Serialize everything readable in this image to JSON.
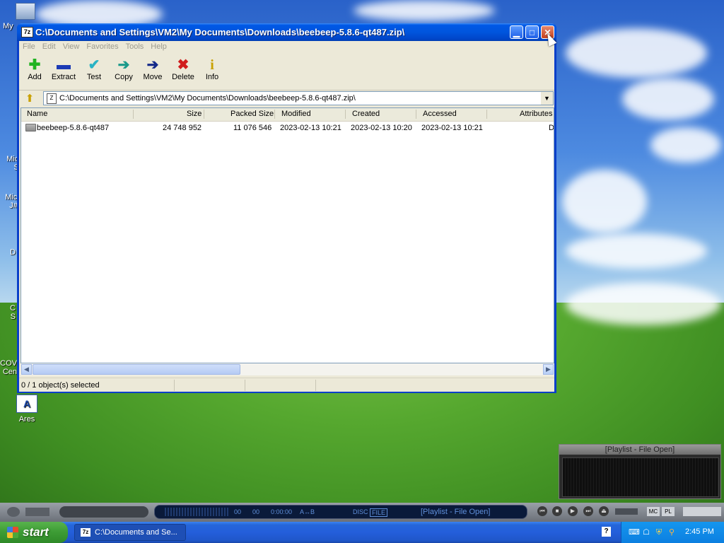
{
  "desktop": {
    "icons": [
      {
        "label": "My"
      },
      {
        "label": "M"
      },
      {
        "label": "Micro\nStu"
      },
      {
        "label": "Micro\nJ# 2"
      },
      {
        "label": "D"
      },
      {
        "label": "C\nS"
      },
      {
        "label": "COV\nCen"
      },
      {
        "label": "Ares"
      }
    ]
  },
  "window": {
    "title": "C:\\Documents and Settings\\VM2\\My Documents\\Downloads\\beebeep-5.8.6-qt487.zip\\",
    "app_icon": "7z",
    "menu": [
      "File",
      "Edit",
      "View",
      "Favorites",
      "Tools",
      "Help"
    ],
    "toolbar": [
      {
        "label": "Add",
        "icon": "plus-icon",
        "color": "#21b321",
        "glyph": "✚"
      },
      {
        "label": "Extract",
        "icon": "minus-icon",
        "color": "#1c3bb5",
        "glyph": "▬"
      },
      {
        "label": "Test",
        "icon": "check-icon",
        "color": "#29b3c4",
        "glyph": "✔"
      },
      {
        "label": "Copy",
        "icon": "copy-arrow-icon",
        "color": "#1a9a8a",
        "glyph": "➔"
      },
      {
        "label": "Move",
        "icon": "move-arrow-icon",
        "color": "#142a8a",
        "glyph": "➔"
      },
      {
        "label": "Delete",
        "icon": "delete-x-icon",
        "color": "#d11d1d",
        "glyph": "✖"
      },
      {
        "label": "Info",
        "icon": "info-icon",
        "color": "#c9a100",
        "glyph": "i"
      }
    ],
    "address": "C:\\Documents and Settings\\VM2\\My Documents\\Downloads\\beebeep-5.8.6-qt487.zip\\",
    "columns": [
      "Name",
      "Size",
      "Packed Size",
      "Modified",
      "Created",
      "Accessed",
      "Attributes"
    ],
    "rows": [
      {
        "name": "beebeep-5.8.6-qt487",
        "size": "24 748 952",
        "packed": "11 076 546",
        "modified": "2023-02-13 10:21",
        "created": "2023-02-13 10:20",
        "accessed": "2023-02-13 10:21",
        "attributes": "D"
      }
    ],
    "status": "0 / 1 object(s) selected"
  },
  "winamp": {
    "playlist_title": "[Playlist - File Open]",
    "display": {
      "time1": "00",
      "time2": "00",
      "time3": "0:00:00",
      "ab": "A↔B",
      "disc": "DISC",
      "file": "FILE",
      "track": "[Playlist - File Open]"
    },
    "mc": "MC",
    "pl": "PL"
  },
  "taskbar": {
    "start": "start",
    "task_label": "C:\\Documents and Se...",
    "clock": "2:45 PM"
  }
}
